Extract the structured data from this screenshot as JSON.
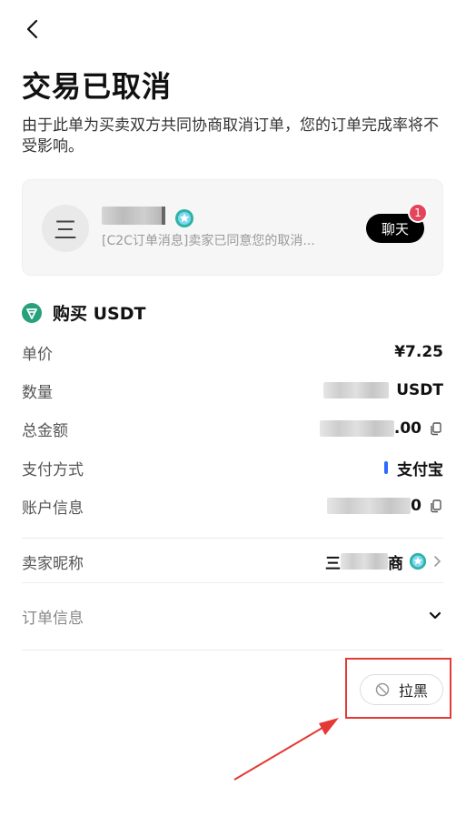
{
  "header": {
    "back_icon": "chevron-left-icon",
    "title": "交易已取消",
    "description": "由于此单为买卖双方共同协商取消订单，您的订单完成率将不受影响。"
  },
  "chat": {
    "avatar_glyph": "三",
    "message": "[C2C订单消息]卖家已同意您的取消...",
    "button_label": "聊天",
    "badge_count": "1"
  },
  "order": {
    "section_title": "购买 USDT",
    "rows": [
      {
        "label": "单价",
        "value": "¥7.25"
      },
      {
        "label": "数量",
        "value": "USDT"
      },
      {
        "label": "总金额",
        "value": ".00"
      },
      {
        "label": "支付方式",
        "value": "支付宝"
      },
      {
        "label": "账户信息",
        "value": "0"
      }
    ],
    "seller_label": "卖家昵称",
    "seller_value_start": "三",
    "seller_value_end": "商",
    "order_info_label": "订单信息"
  },
  "actions": {
    "block_label": "拉黑"
  },
  "colors": {
    "annotation_red": "#e53935",
    "alipay_blue": "#2d6bff",
    "badge_red": "#e4455c",
    "verify_teal": "#2bb3a6"
  }
}
